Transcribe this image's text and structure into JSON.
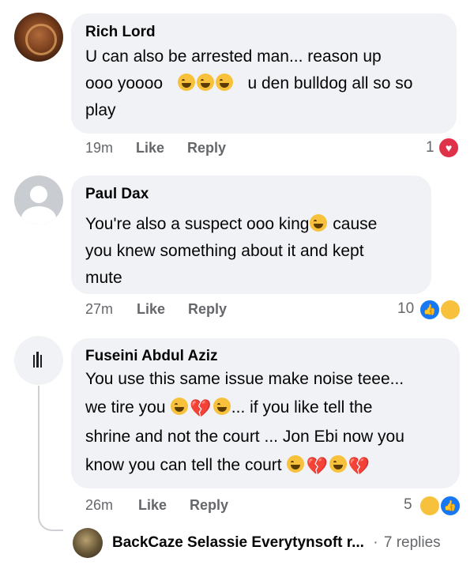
{
  "comments": [
    {
      "name": "Rich Lord",
      "text_lines": [
        "U can also be arrested man... reason up",
        "ooo yoooo",
        "u den bulldog all so so",
        "play"
      ],
      "time": "19m",
      "like": "Like",
      "reply": "Reply",
      "reaction_count": "1"
    },
    {
      "name": "Paul Dax",
      "text_lines": [
        "You're also a suspect ooo king",
        "cause",
        "you knew something about it and kept",
        "mute"
      ],
      "time": "27m",
      "like": "Like",
      "reply": "Reply",
      "reaction_count": "10"
    },
    {
      "name": "Fuseini Abdul Aziz",
      "text_lines": [
        "You use this same issue make noise teee...",
        "we tire you",
        "... if you like tell the",
        "shrine and not the court ... Jon Ebi now you",
        "know you can tell the court"
      ],
      "time": "26m",
      "like": "Like",
      "reply": "Reply",
      "reaction_count": "5"
    }
  ],
  "reply_preview": {
    "name": "BackCaze Selassie Everytynsoft r...",
    "separator": "·",
    "replies": "7 replies"
  },
  "colors": {
    "bubble": "#f0f2f5",
    "meta": "#65676b",
    "like_blue": "#1877f2",
    "love_red": "#e0314b",
    "haha_yellow": "#f7c13b"
  }
}
